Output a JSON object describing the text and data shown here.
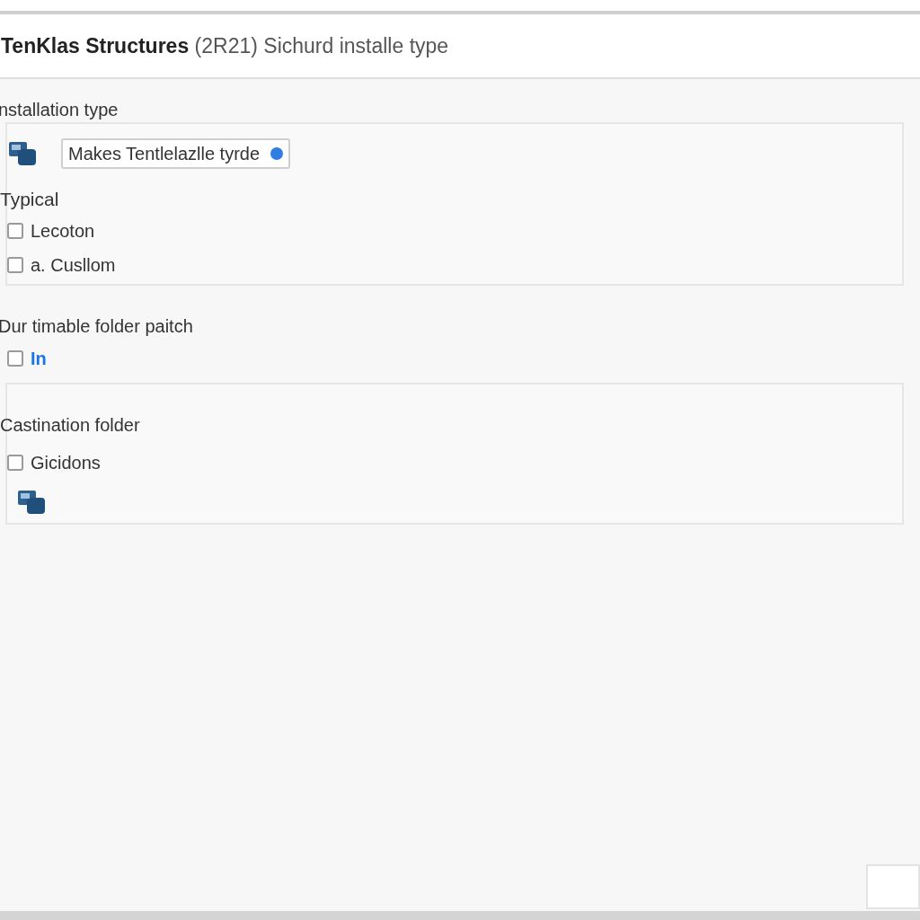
{
  "title": "**TenKlas Structures** (2R21) Sichurd installe type",
  "installation": {
    "label": "nstallation type",
    "dropdown": "Makes Tentlelazlle tyrde",
    "group_label": "Typical",
    "options": [
      {
        "label": "Lecoton",
        "checked": false
      },
      {
        "label": "a. Cusllom",
        "checked": false
      }
    ]
  },
  "path": {
    "label": "Dur timable folder paitch",
    "option": {
      "label": "In",
      "checked": false
    }
  },
  "destination": {
    "label": "Castination folder",
    "option": {
      "label": "Gicidons",
      "checked": false
    }
  }
}
